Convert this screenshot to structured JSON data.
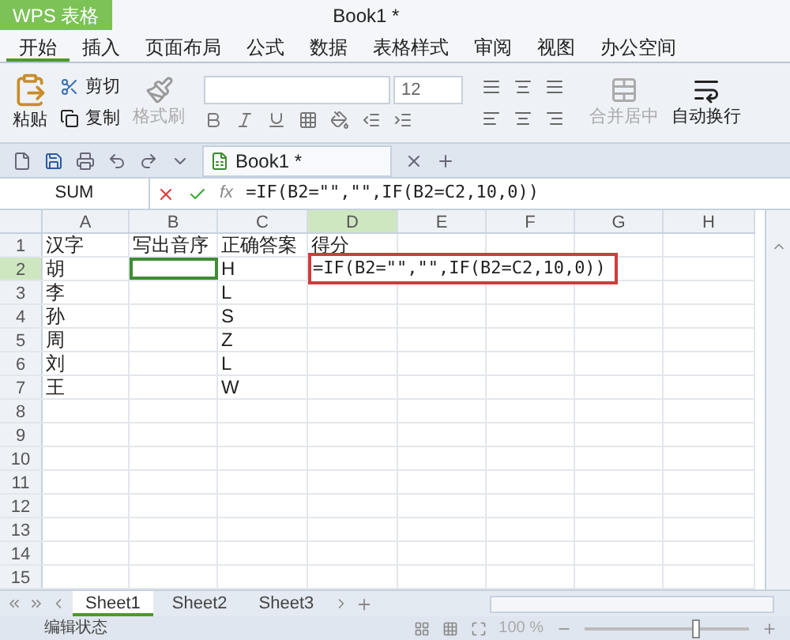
{
  "app_button": {
    "label": "WPS 表格"
  },
  "window": {
    "title": "Book1 *"
  },
  "menu_tabs": [
    {
      "label": "开始",
      "selected": true
    },
    {
      "label": "插入",
      "selected": false
    },
    {
      "label": "页面布局",
      "selected": false
    },
    {
      "label": "公式",
      "selected": false
    },
    {
      "label": "数据",
      "selected": false
    },
    {
      "label": "表格样式",
      "selected": false
    },
    {
      "label": "审阅",
      "selected": false
    },
    {
      "label": "视图",
      "selected": false
    },
    {
      "label": "办公空间",
      "selected": false
    }
  ],
  "ribbon": {
    "paste": "粘贴",
    "cut": "剪切",
    "copy": "复制",
    "format_painter": {
      "label": "格式刷",
      "disabled": true
    },
    "font_size": "12",
    "merge": {
      "label": "合并居中",
      "disabled": true
    },
    "wrap": {
      "label": "自动换行",
      "disabled": false
    }
  },
  "doc_tab": {
    "label": "Book1 *"
  },
  "formula_bar": {
    "name_box": "SUM",
    "fx": "fx",
    "formula": "=IF(B2=\"\",\"\",IF(B2=C2,10,0))"
  },
  "columns": [
    {
      "label": "A",
      "selected": false
    },
    {
      "label": "B",
      "selected": false
    },
    {
      "label": "C",
      "selected": false
    },
    {
      "label": "D",
      "selected": true
    },
    {
      "label": "E",
      "selected": false
    },
    {
      "label": "F",
      "selected": false
    },
    {
      "label": "G",
      "selected": false
    },
    {
      "label": "H",
      "selected": false
    }
  ],
  "rows": [
    {
      "label": "1",
      "selected": false,
      "cells": [
        "汉字",
        "写出音序",
        "正确答案",
        "得分"
      ]
    },
    {
      "label": "2",
      "selected": true,
      "cells": [
        "胡",
        "",
        "H",
        "=IF(B2=\"\",\"\",IF(B2=C2,10,0))"
      ]
    },
    {
      "label": "3",
      "selected": false,
      "cells": [
        "李",
        "",
        "L",
        ""
      ]
    },
    {
      "label": "4",
      "selected": false,
      "cells": [
        "孙",
        "",
        "S",
        ""
      ]
    },
    {
      "label": "5",
      "selected": false,
      "cells": [
        "周",
        "",
        "Z",
        ""
      ]
    },
    {
      "label": "6",
      "selected": false,
      "cells": [
        "刘",
        "",
        "L",
        ""
      ]
    },
    {
      "label": "7",
      "selected": false,
      "cells": [
        "王",
        "",
        "W",
        ""
      ]
    },
    {
      "label": "8",
      "selected": false,
      "cells": []
    },
    {
      "label": "9",
      "selected": false,
      "cells": []
    },
    {
      "label": "10",
      "selected": false,
      "cells": []
    },
    {
      "label": "11",
      "selected": false,
      "cells": []
    },
    {
      "label": "12",
      "selected": false,
      "cells": []
    },
    {
      "label": "13",
      "selected": false,
      "cells": []
    },
    {
      "label": "14",
      "selected": false,
      "cells": []
    },
    {
      "label": "15",
      "selected": false,
      "cells": []
    }
  ],
  "sheet_tabs": [
    {
      "label": "Sheet1",
      "selected": true
    },
    {
      "label": "Sheet2",
      "selected": false
    },
    {
      "label": "Sheet3",
      "selected": false
    }
  ],
  "status_bar": {
    "mode": "编辑状态",
    "zoom": "100 %",
    "zoom_slider": {
      "level": 0.68
    }
  }
}
